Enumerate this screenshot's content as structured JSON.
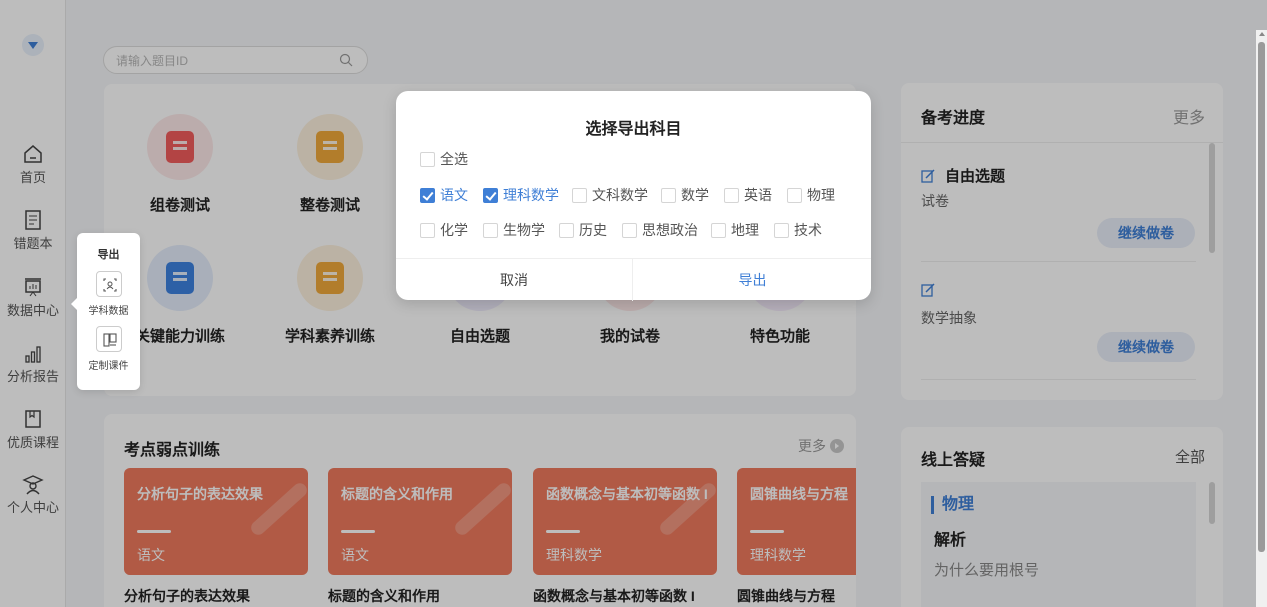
{
  "nav": {
    "items": [
      {
        "label": "首页",
        "icon": "home-icon"
      },
      {
        "label": "错题本",
        "icon": "notebook-icon"
      },
      {
        "label": "数据中心",
        "icon": "data-board-icon"
      },
      {
        "label": "分析报告",
        "icon": "bar-chart-icon"
      },
      {
        "label": "优质课程",
        "icon": "book-icon"
      },
      {
        "label": "个人中心",
        "icon": "graduate-icon"
      }
    ]
  },
  "search": {
    "placeholder": "请输入题目ID"
  },
  "functions": [
    {
      "label": "组卷测试",
      "color": "#f25c5c",
      "bg": "#fde9e9"
    },
    {
      "label": "整卷测试",
      "color": "#f0a93a",
      "bg": "#fdf1dd"
    },
    {
      "label": "关键能力训练",
      "color": "#3d82e0",
      "bg": "#e4edfb"
    },
    {
      "label": "学科素养训练",
      "color": "#f0a93a",
      "bg": "#fdf1dd"
    },
    {
      "label": "自由选题",
      "color": "#8b7be8",
      "bg": "#efecfc"
    },
    {
      "label": "我的试卷",
      "color": "#f25c5c",
      "bg": "#fde9e9"
    },
    {
      "label": "特色功能",
      "color": "#c880e8",
      "bg": "#f6ecfc"
    }
  ],
  "weak": {
    "title": "考点弱点训练",
    "more": "更多",
    "tiles": [
      {
        "title": "分析句子的表达效果",
        "subject": "语文",
        "caption": "分析句子的表达效果"
      },
      {
        "title": "标题的含义和作用",
        "subject": "语文",
        "caption": "标题的含义和作用"
      },
      {
        "title": "函数概念与基本初等函数 I",
        "subject": "理科数学",
        "caption": "函数概念与基本初等函数 I"
      },
      {
        "title": "圆锥曲线与方程",
        "subject": "理科数学",
        "caption": "圆锥曲线与方程"
      }
    ]
  },
  "prep": {
    "title": "备考进度",
    "more": "更多",
    "items": [
      {
        "title": "自由选题",
        "sub": "试卷",
        "button": "继续做卷"
      },
      {
        "title": "",
        "sub": "数学抽象",
        "button": "继续做卷"
      }
    ]
  },
  "qa": {
    "title": "线上答疑",
    "all": "全部",
    "subject": "物理",
    "item_title": "解析",
    "item_text": "为什么要用根号"
  },
  "popover": {
    "title": "导出",
    "items": [
      {
        "label": "学科数据",
        "icon": "scan-icon"
      },
      {
        "label": "定制课件",
        "icon": "courseware-icon"
      }
    ]
  },
  "dialog": {
    "title": "选择导出科目",
    "select_all": "全选",
    "row1": [
      {
        "label": "语文",
        "checked": true
      },
      {
        "label": "理科数学",
        "checked": true
      },
      {
        "label": "文科数学",
        "checked": false
      },
      {
        "label": "数学",
        "checked": false
      },
      {
        "label": "英语",
        "checked": false
      },
      {
        "label": "物理",
        "checked": false
      }
    ],
    "row2": [
      {
        "label": "化学",
        "checked": false
      },
      {
        "label": "生物学",
        "checked": false
      },
      {
        "label": "历史",
        "checked": false
      },
      {
        "label": "思想政治",
        "checked": false
      },
      {
        "label": "地理",
        "checked": false
      },
      {
        "label": "技术",
        "checked": false
      }
    ],
    "cancel": "取消",
    "confirm": "导出"
  },
  "colors": {
    "accent": "#3f7fd6",
    "tile": "#ef7a5e"
  }
}
